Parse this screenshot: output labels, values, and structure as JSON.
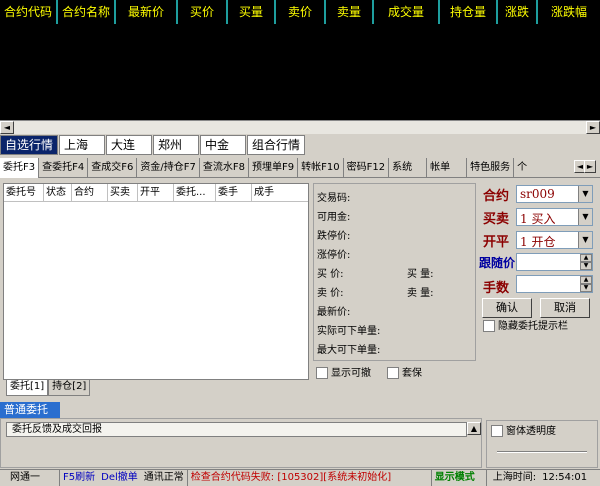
{
  "quote_board": {
    "columns": [
      {
        "label": "合约代码",
        "color": "yellow"
      },
      {
        "label": "合约名称",
        "color": "yellow"
      },
      {
        "label": "最新价",
        "color": "yellow"
      },
      {
        "label": "买价",
        "color": "yellow"
      },
      {
        "label": "买量",
        "color": "yellow"
      },
      {
        "label": "卖价",
        "color": "yellow"
      },
      {
        "label": "卖量",
        "color": "yellow"
      },
      {
        "label": "成交量",
        "color": "yellow"
      },
      {
        "label": "持仓量",
        "color": "yellow"
      },
      {
        "label": "涨跌",
        "color": "yellow"
      },
      {
        "label": "涨跌幅",
        "color": "yellow"
      }
    ]
  },
  "market_tabs": [
    "自选行情",
    "上海",
    "大连",
    "郑州",
    "中金",
    "组合行情"
  ],
  "function_tabs": [
    "委托F3",
    "查委托F4",
    "查成交F6",
    "资金/持仓F7",
    "查流水F8",
    "预埋单F9",
    "转帐F10",
    "密码F12",
    "系统",
    "帐单",
    "特色服务",
    "个"
  ],
  "order_table": {
    "columns": [
      "委托号",
      "状态",
      "合约",
      "买卖",
      "开平",
      "委托...",
      "委手",
      "成手"
    ]
  },
  "bottom_tabs": [
    "委托[1]",
    "持仓[2]"
  ],
  "info_panel": {
    "contract_code": "交易码:",
    "available": "可用金:",
    "limit_down": "跌停价:",
    "limit_up": "涨停价:",
    "bid_price": "买    价:",
    "bid_qty": "买  量:",
    "ask_price": "卖    价:",
    "ask_qty": "卖  量:",
    "last_price": "最新价:",
    "max_real": "实际可下单量:",
    "max_order": "最大可下单量:"
  },
  "checkboxes": {
    "show_cancelable": "显示可撤",
    "hedge": "套保",
    "hide_hint": "隐藏委托提示栏",
    "transparency": "窗体透明度"
  },
  "order_form": {
    "contract_label": "合约",
    "contract_value": "sr009",
    "side_label": "买卖",
    "side_value": "1 买入",
    "offset_label": "开平",
    "offset_value": "1 开仓",
    "follow_price_label": "跟随价",
    "qty_label": "手数",
    "confirm": "确认",
    "cancel": "取消"
  },
  "lower": {
    "tab": "普通委托",
    "feedback": "委托反馈及成交回报"
  },
  "status_bar": {
    "server": "网通一",
    "f5": "F5刷新",
    "del": "Del撤单",
    "conn": "通讯正常",
    "error": "检查合约代码失败: [105302][系统未初始化]",
    "mode": "显示模式",
    "time_label": "上海时间:",
    "time": "12:54:01"
  },
  "colors": {
    "quote_bg": "#000000",
    "header_text": "#ffff00",
    "active_tab": "#0a246a",
    "form_label": "#8b0000",
    "status_error": "#c00000",
    "status_mode": "#008000"
  }
}
